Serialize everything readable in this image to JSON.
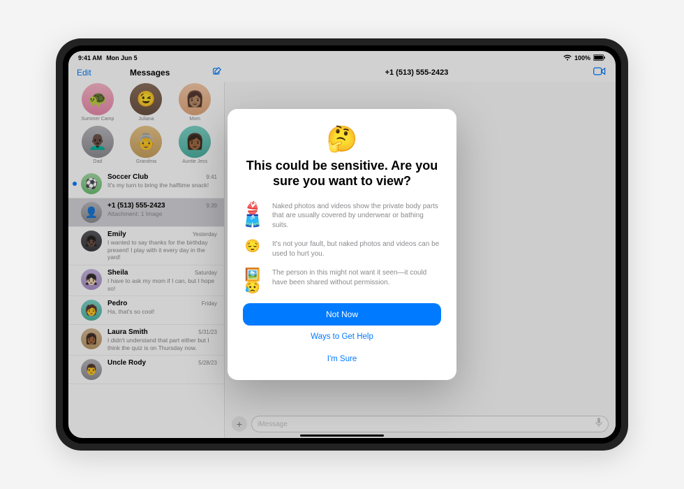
{
  "status": {
    "time": "9:41 AM",
    "date": "Mon Jun 5",
    "battery": "100%"
  },
  "header": {
    "edit": "Edit",
    "title": "Messages",
    "conversation_title": "+1 (513) 555-2423"
  },
  "pins": [
    {
      "label": "Summer Camp",
      "emoji": "🐢",
      "bg": "bg-pink"
    },
    {
      "label": "Juliana",
      "emoji": "😉",
      "bg": "bg-brown"
    },
    {
      "label": "Mom",
      "emoji": "👩🏽",
      "bg": "bg-peach"
    },
    {
      "label": "Dad",
      "emoji": "👨🏿‍🦲",
      "bg": "bg-grey"
    },
    {
      "label": "Grandma",
      "emoji": "👵",
      "bg": "bg-gold"
    },
    {
      "label": "Auntie Jess",
      "emoji": "👩🏾",
      "bg": "bg-teal"
    }
  ],
  "conversations": [
    {
      "name": "Soccer Club",
      "time": "9:41",
      "preview": "It's my turn to bring the halftime snack!",
      "unread": true,
      "avatar": "⚽",
      "bg": "bg-green"
    },
    {
      "name": "+1 (513) 555-2423",
      "time": "9:39",
      "preview": "Attachment: 1 Image",
      "selected": true,
      "avatar": "👤",
      "bg": "bg-grey"
    },
    {
      "name": "Emily",
      "time": "Yesterday",
      "preview": "I wanted to say thanks for the birthday present! I play with it every day in the yard!",
      "avatar": "👧🏿",
      "bg": "bg-dark"
    },
    {
      "name": "Sheila",
      "time": "Saturday",
      "preview": "I have to ask my mom if I can, but I hope so!",
      "avatar": "👧🏻",
      "bg": "bg-lav"
    },
    {
      "name": "Pedro",
      "time": "Friday",
      "preview": "Ha, that's so cool!",
      "avatar": "🧑",
      "bg": "bg-teal"
    },
    {
      "name": "Laura Smith",
      "time": "5/31/23",
      "preview": "I didn't understand that part either but I think the quiz is on Thursday now.",
      "avatar": "👩🏾",
      "bg": "bg-tan"
    },
    {
      "name": "Uncle Rody",
      "time": "5/28/23",
      "preview": "",
      "avatar": "👨",
      "bg": "bg-grey"
    }
  ],
  "input": {
    "placeholder": "iMessage"
  },
  "modal": {
    "emoji": "🤔",
    "title": "This could be sensitive. Are you sure you want to view?",
    "reasons": [
      {
        "icon": "👙🩳",
        "text": "Naked photos and videos show the private body parts that are usually covered by underwear or bathing suits."
      },
      {
        "icon": "😔",
        "text": "It's not your fault, but naked photos and videos can be used to hurt you."
      },
      {
        "icon": "🖼️😥",
        "text": "The person in this might not want it seen—it could have been shared without permission."
      }
    ],
    "primary": "Not Now",
    "secondary1": "Ways to Get Help",
    "secondary2": "I'm Sure"
  }
}
